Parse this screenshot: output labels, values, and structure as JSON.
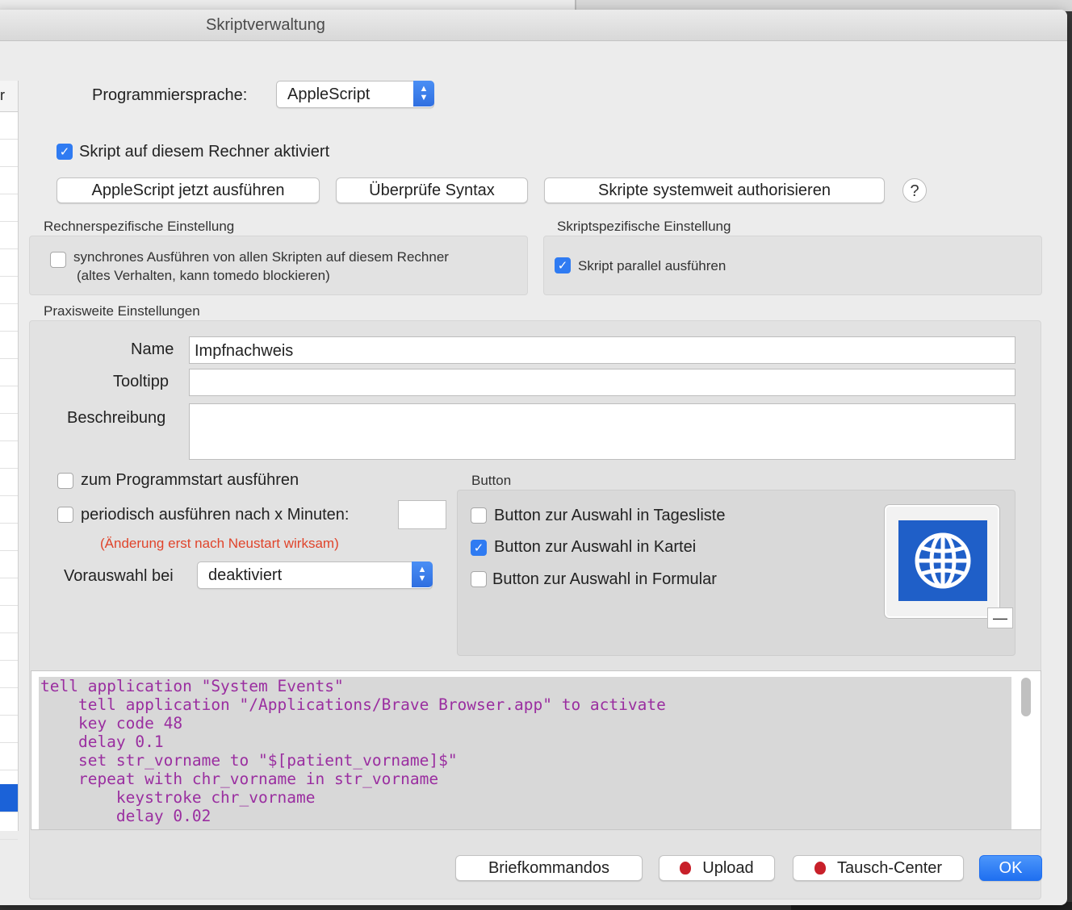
{
  "window": {
    "title": "Skriptverwaltung"
  },
  "left_list": {
    "header": "r"
  },
  "language": {
    "label": "Programmiersprache:",
    "value": "AppleScript"
  },
  "activate": {
    "label": "Skript auf diesem Rechner aktiviert",
    "checked": true
  },
  "actions": {
    "run": "AppleScript jetzt ausführen",
    "syntax": "Überprüfe Syntax",
    "authorize": "Skripte systemweit authorisieren",
    "help": "?"
  },
  "computer_settings": {
    "title": "Rechnerspezifische Einstellung",
    "sync_line1": "synchrones Ausführen von allen Skripten auf diesem Rechner",
    "sync_line2": "(altes Verhalten, kann tomedo blockieren)",
    "sync_checked": false
  },
  "script_settings": {
    "title": "Skriptspezifische Einstellung",
    "parallel": "Skript parallel ausführen",
    "parallel_checked": true
  },
  "practice": {
    "title": "Praxisweite Einstellungen",
    "name_label": "Name",
    "name_value": "Impfnachweis",
    "tooltip_label": "Tooltipp",
    "tooltip_value": "",
    "description_label": "Beschreibung",
    "description_value": "",
    "on_start": "zum Programmstart ausführen",
    "periodic": "periodisch ausführen nach x Minuten:",
    "periodic_value": "",
    "restart_note": "(Änderung erst nach Neustart wirksam)",
    "preselect_label": "Vorauswahl bei",
    "preselect_value": "deaktiviert"
  },
  "button_group": {
    "title": "Button",
    "daylist": "Button zur Auswahl in Tagesliste",
    "daylist_checked": false,
    "kartei": "Button zur Auswahl in Kartei",
    "kartei_checked": true,
    "formular": "Button zur Auswahl in Formular",
    "formular_checked": false,
    "icon": "globe-icon",
    "remove": "—"
  },
  "code": {
    "lines": [
      "tell application \"System Events\"",
      "    tell application \"/Applications/Brave Browser.app\" to activate",
      "    key code 48",
      "    delay 0.1",
      "    set str_vorname to \"$[patient_vorname]$\"",
      "    repeat with chr_vorname in str_vorname",
      "        keystroke chr_vorname",
      "        delay 0.02"
    ]
  },
  "footer": {
    "letters": "Briefkommandos",
    "upload": "Upload",
    "exchange": "Tausch-Center",
    "ok": "OK"
  },
  "colors": {
    "accent": "#2f7bf2",
    "note": "#e0442b",
    "code_text": "#9a2ea0",
    "icon_tile": "#1f5fc8"
  }
}
